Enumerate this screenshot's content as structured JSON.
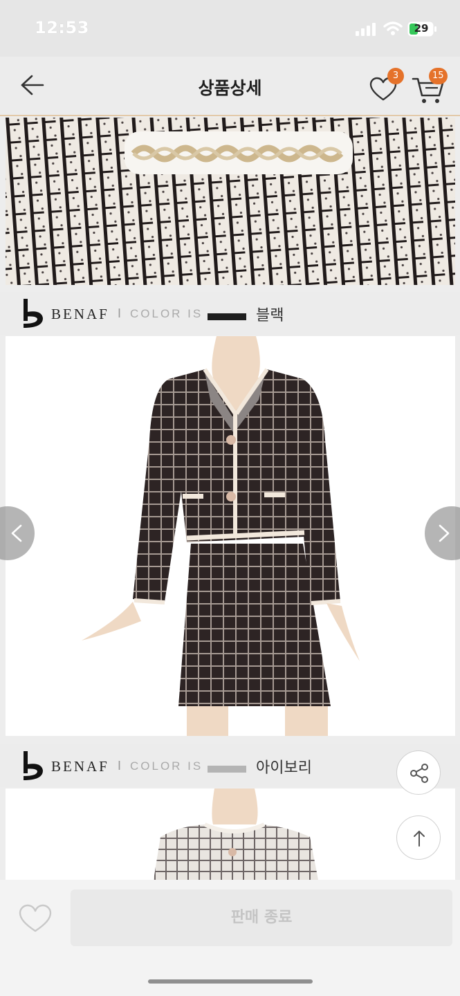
{
  "status_bar": {
    "time": "12:53",
    "battery": "29"
  },
  "header": {
    "title": "상품상세",
    "wishlist_count": "3",
    "cart_count": "15"
  },
  "sections": [
    {
      "brand": "BENAF",
      "separator": "I",
      "color_label": "COLOR IS",
      "swatch_color": "#1e1e1e",
      "color_name": "블랙"
    },
    {
      "brand": "BENAF",
      "separator": "I",
      "color_label": "COLOR IS",
      "swatch_color": "#b4b4b4",
      "color_name": "아이보리"
    }
  ],
  "bottom_bar": {
    "sold_out_label": "판매 종료"
  },
  "colors": {
    "badge": "#e5722a",
    "header_divider": "#e3c9a8",
    "garment_dark": "#2d2424",
    "garment_trim": "#f2e8dc"
  },
  "icons": {
    "back": "back-arrow-icon",
    "wishlist": "heart-icon",
    "cart": "cart-icon",
    "share": "share-icon",
    "scroll_top": "arrow-up-icon"
  }
}
